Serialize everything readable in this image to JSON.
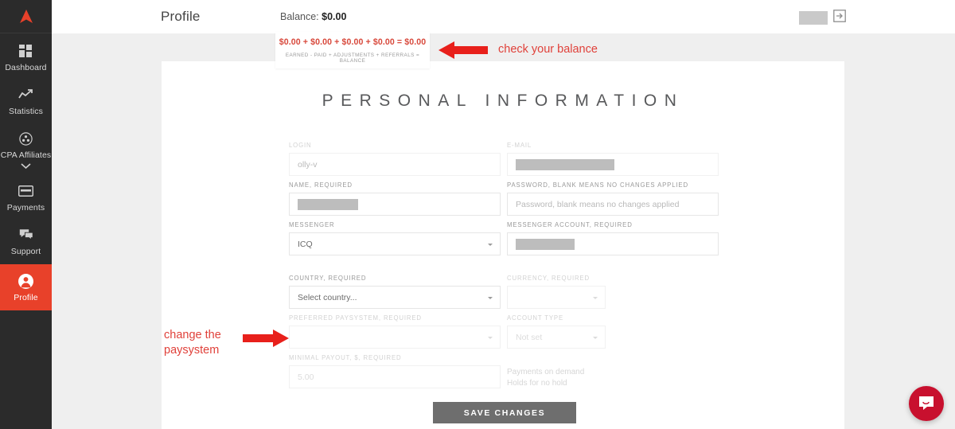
{
  "brand": {
    "logo_name": "arrow-logo",
    "accent": "#e8412a",
    "sidebar_bg": "#2b2b2b",
    "annotation_color": "#e0413a"
  },
  "sidebar": {
    "items": [
      {
        "label": "Dashboard",
        "icon": "grid-icon",
        "active": false,
        "has_chevron": false
      },
      {
        "label": "Statistics",
        "icon": "trend-up-icon",
        "active": false,
        "has_chevron": false
      },
      {
        "label": "CPA Affiliates",
        "icon": "users-circle-icon",
        "active": false,
        "has_chevron": true
      },
      {
        "label": "Payments",
        "icon": "credit-card-icon",
        "active": false,
        "has_chevron": false
      },
      {
        "label": "Support",
        "icon": "chat-bubbles-icon",
        "active": false,
        "has_chevron": false
      },
      {
        "label": "Profile",
        "icon": "user-circle-icon",
        "active": true,
        "has_chevron": false
      }
    ]
  },
  "topbar": {
    "page_title": "Profile",
    "balance_label": "Balance:",
    "balance_value": "$0.00",
    "user_name_redacted": "",
    "logout_icon": "logout-icon"
  },
  "balance_tooltip": {
    "sum": "$0.00 + $0.00 + $0.00 + $0.00 = $0.00",
    "legend": "EARNED - PAID + ADJUSTMENTS + REFERRALS = BALANCE"
  },
  "annotations": [
    {
      "text": "check your balance",
      "arrow": "arrow-left"
    },
    {
      "text": "change the paysystem",
      "arrow": "arrow-right"
    }
  ],
  "form": {
    "section_title": "PERSONAL INFORMATION",
    "fields": [
      {
        "name": "login",
        "label": "LOGIN",
        "value": "olly-v",
        "type": "text",
        "redacted": false,
        "muted": true
      },
      {
        "name": "email",
        "label": "E-MAIL",
        "value": "",
        "type": "text",
        "redacted": true,
        "redaction_width": 124,
        "muted": true
      },
      {
        "name": "name",
        "label": "NAME, REQUIRED",
        "value": "",
        "type": "text",
        "redacted": true,
        "redaction_width": 76,
        "muted": false
      },
      {
        "name": "password",
        "label": "PASSWORD, BLANK MEANS NO CHANGES APPLIED",
        "value": "Password, blank means no changes applied",
        "type": "text",
        "redacted": false,
        "muted": false
      },
      {
        "name": "messenger",
        "label": "MESSENGER",
        "value": "ICQ",
        "type": "select",
        "redacted": false,
        "muted": false
      },
      {
        "name": "messenger-account",
        "label": "MESSENGER ACCOUNT, REQUIRED",
        "value": "",
        "type": "text",
        "redacted": true,
        "redaction_width": 74,
        "muted": false
      },
      {
        "name": "country",
        "label": "COUNTRY, REQUIRED",
        "value": "Select country...",
        "type": "select",
        "redacted": false,
        "muted": false
      },
      {
        "name": "currency",
        "label": "CURRENCY, REQUIRED",
        "value": "",
        "type": "select",
        "redacted": false,
        "muted": true
      },
      {
        "name": "paysystem",
        "label": "PREFERRED PAYSYSTEM, REQUIRED",
        "value": "",
        "type": "select",
        "redacted": false,
        "muted": true
      },
      {
        "name": "account-type",
        "label": "ACCOUNT TYPE",
        "value": "Not set",
        "type": "select",
        "redacted": false,
        "muted": true
      },
      {
        "name": "minimal-payout",
        "label": "MINIMAL PAYOUT, $, REQUIRED",
        "value": "5.00",
        "type": "text",
        "redacted": false,
        "muted": true
      }
    ],
    "notes": {
      "line1": "Payments on demand",
      "line2": "Holds for no hold"
    },
    "save_label": "SAVE CHANGES"
  },
  "chat": {
    "icon": "chat-smile-icon",
    "color": "#c8102e"
  }
}
